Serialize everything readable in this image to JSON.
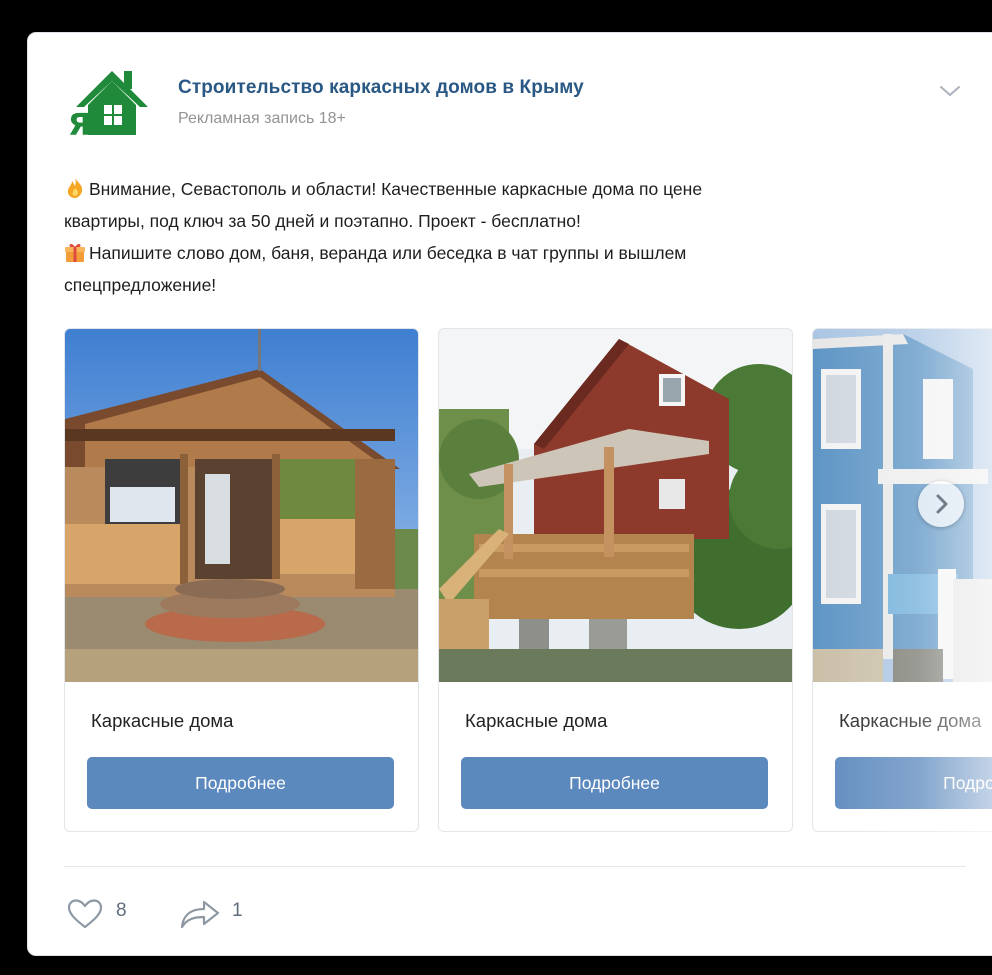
{
  "post": {
    "group_name": "Строительство каркасных домов в Крыму",
    "ad_label": "Рекламная запись 18+",
    "text_line1": "Внимание, Севастополь и области! Качественные каркасные дома по цене",
    "text_line2": "квартиры, под ключ за 50 дней и поэтапно. Проект - бесплатно!",
    "text_line3": "Напишите слово дом, баня, веранда или беседка в чат группы и вышлем",
    "text_line4": "спецпредложение!",
    "emoji1": "fire-icon",
    "emoji2": "gift-icon"
  },
  "logo": {
    "text": "Я",
    "color": "#1f8a3a"
  },
  "carousel": {
    "items": [
      {
        "title": "Каркасные дома",
        "button": "Подробнее"
      },
      {
        "title": "Каркасные дома",
        "button": "Подробнее"
      },
      {
        "title": "Каркасные дома",
        "button": "Подробнее"
      }
    ]
  },
  "footer": {
    "likes": "8",
    "shares": "1"
  },
  "colors": {
    "link": "#2a5885",
    "button": "#5b88bd",
    "muted": "#939393"
  }
}
